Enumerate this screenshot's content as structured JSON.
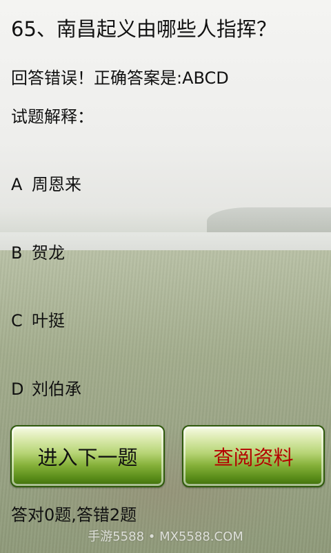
{
  "question": {
    "text": "65、南昌起义由哪些人指挥？"
  },
  "result": {
    "text": "回答错误！正确答案是:ABCD"
  },
  "explanation": {
    "label": "试题解释："
  },
  "options": [
    {
      "letter": "A",
      "text": "周恩来"
    },
    {
      "letter": "B",
      "text": "贺龙"
    },
    {
      "letter": "C",
      "text": "叶挺"
    },
    {
      "letter": "D",
      "text": "刘伯承"
    }
  ],
  "buttons": {
    "next_label": "进入下一题",
    "info_label": "查阅资料"
  },
  "score": {
    "text": "答对0题,答错2题"
  },
  "watermark": {
    "text": "手游5588 • MX5588.COM"
  },
  "colors": {
    "button_green": "#86b13a",
    "info_label_red": "#b40000"
  }
}
